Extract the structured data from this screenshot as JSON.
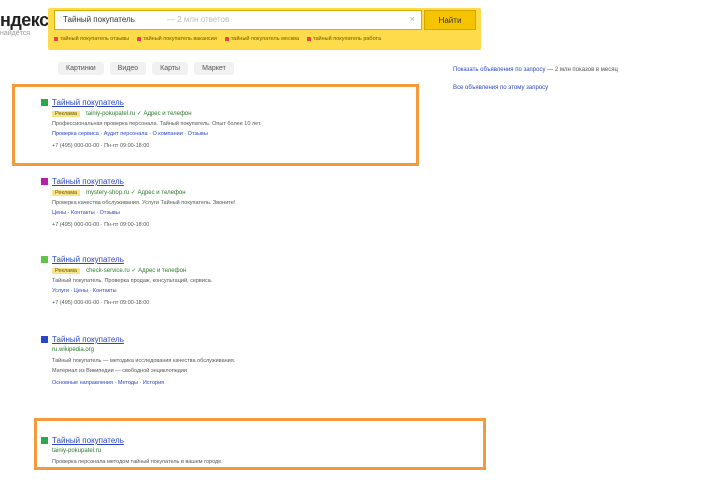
{
  "logo": {
    "text": "ндекс",
    "sub": "найдётся"
  },
  "search": {
    "query": "Тайный покупатель",
    "hint": "— 2 млн ответов",
    "clear": "×",
    "button_label": "Найти",
    "suggestions": [
      "тайный покупатель отзывы",
      "тайный покупатель вакансии",
      "тайный покупатель москва",
      "тайный покупатель работа"
    ]
  },
  "tabs": [
    "Картинки",
    "Видео",
    "Карты",
    "Маркет"
  ],
  "results": [
    {
      "title": "Тайный покупатель",
      "url": "tainiy-pokupatel.ru",
      "ad": "Реклама",
      "url_extra": "✓ Адрес и телефон",
      "lines": [
        "Профессиональная проверка персонала. Тайный покупатель. Опыт более 10 лет.",
        "Проверка сервиса · Аудит персонала · О компании · Отзывы",
        "+7 (495) 000-00-00 · Пн-пт 09:00-18:00"
      ],
      "favicon_color": "#2ba84a"
    },
    {
      "title": "Тайный покупатель",
      "url": "mystery-shop.ru",
      "ad": "Реклама",
      "url_extra": "✓ Адрес и телефон",
      "lines": [
        "Проверка качества обслуживания. Услуги Тайный покупатель. Звоните!",
        "Цены · Контакты · Отзывы",
        "+7 (495) 000-00-00 · Пн-пт 09:00-18:00"
      ],
      "favicon_color": "#b520a8"
    },
    {
      "title": "Тайный покупатель",
      "url": "check-service.ru",
      "ad": "Реклама",
      "url_extra": "✓ Адрес и телефон",
      "lines": [
        "Тайный покупатель. Проверка продаж, консультаций, сервиса.",
        "Услуги · Цены · Контакты",
        "+7 (495) 000-00-00 · Пн-пт 09:00-18:00"
      ],
      "favicon_color": "#62c24a"
    },
    {
      "title": "Тайный покупатель",
      "url": "ru.wikipedia.org",
      "ad": "",
      "url_extra": "",
      "lines": [
        "Тайный покупатель — методика исследования качества обслуживания.",
        "Материал из Википедии — свободной энциклопедии",
        "Основные направления · Методы · История"
      ],
      "favicon_color": "#2a46c8"
    },
    {
      "title": "Тайный покупатель",
      "url": "tainiy-pokupatel.ru",
      "ad": "",
      "url_extra": "",
      "lines": [
        "Проверка персонала методом тайный покупатель в вашем городе."
      ],
      "favicon_color": "#2ba84a"
    }
  ],
  "right": {
    "link1": "Показать объявления по запросу",
    "text1": "— 2 млн показов в месяц",
    "link2": "Все объявления по этому запросу"
  },
  "colors": {
    "accent": "#fedb4a",
    "highlight": "#f59a3c",
    "link": "#2a46c8",
    "url": "#2c7a2c"
  }
}
